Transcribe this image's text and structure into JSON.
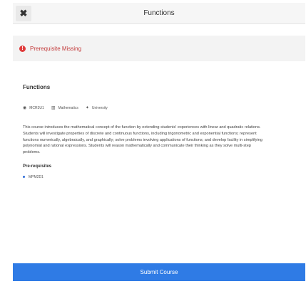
{
  "header": {
    "close_symbol": "✖",
    "title": "Functions"
  },
  "alert": {
    "icon": "alert-circle-icon",
    "icon_symbol": "!",
    "text": "Prerequisite Missing",
    "color": "#e03c3c"
  },
  "course": {
    "title": "Functions",
    "meta": [
      {
        "icon": "target-icon",
        "symbol": "◉",
        "label": "MCR3U1"
      },
      {
        "icon": "chart-bar-icon",
        "symbol": "▥",
        "label": "Mathematics"
      },
      {
        "icon": "graduation-icon",
        "symbol": "✦",
        "label": "University"
      }
    ],
    "description": "This course introduces the mathematical concept of the function by extending students' experiences with linear and quadratic relations. Students will investigate properties of discrete and continuous functions, including trigonometric and exponential functions; represent functions numerically, algebraically, and graphically; solve problems involving applications of functions; and develop facility in simplifying polynomial and rational expressions. Students will reason mathematically and communicate their thinking as they solve multi-step problems.",
    "prerequisites_title": "Pre-requisites",
    "prerequisites": [
      "MPM2D1"
    ]
  },
  "submit": {
    "label": "Submit Course"
  },
  "colors": {
    "accent": "#2f7be5",
    "alert_text": "#c33b3b",
    "header_bg": "#f6f6f6"
  }
}
